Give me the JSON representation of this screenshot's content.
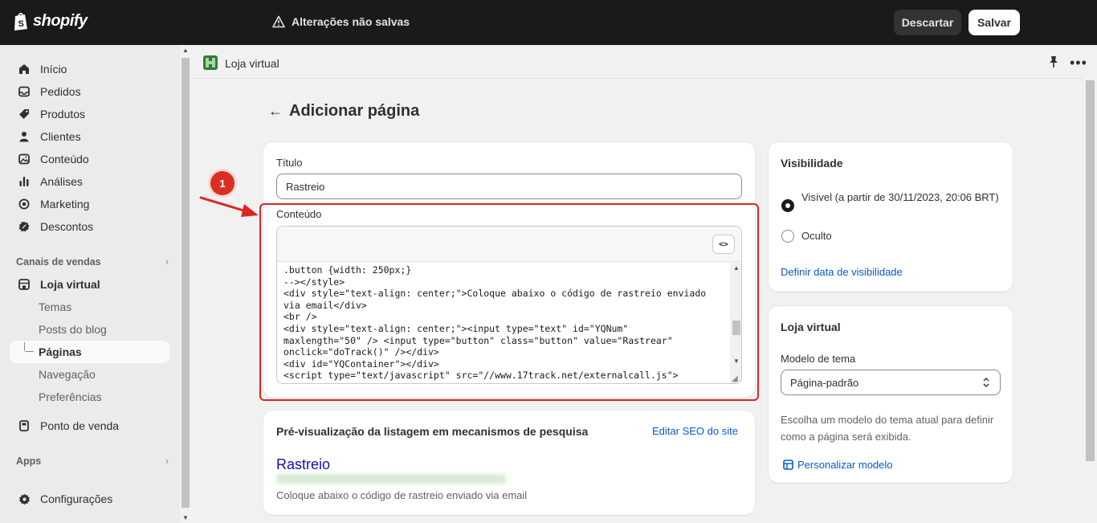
{
  "topbar": {
    "logo_text": "shopify",
    "unsaved_text": "Alterações não salvas",
    "discard_label": "Descartar",
    "save_label": "Salvar"
  },
  "sidebar": {
    "items": [
      {
        "label": "Início",
        "icon": "home-icon"
      },
      {
        "label": "Pedidos",
        "icon": "inbox-icon"
      },
      {
        "label": "Produtos",
        "icon": "tag-icon"
      },
      {
        "label": "Clientes",
        "icon": "person-icon"
      },
      {
        "label": "Conteúdo",
        "icon": "image-icon"
      },
      {
        "label": "Análises",
        "icon": "bar-chart-icon"
      },
      {
        "label": "Marketing",
        "icon": "target-icon"
      },
      {
        "label": "Descontos",
        "icon": "discount-icon"
      }
    ],
    "sales_channels_label": "Canais de vendas",
    "online_store": {
      "label": "Loja virtual",
      "icon": "storefront-icon",
      "subitems": [
        "Temas",
        "Posts do blog",
        "Páginas",
        "Navegação",
        "Preferências"
      ],
      "active": "Páginas"
    },
    "pos_label": "Ponto de venda",
    "apps_label": "Apps",
    "settings_label": "Configurações"
  },
  "header": {
    "store_name": "Loja virtual"
  },
  "page": {
    "title": "Adicionar página",
    "title_label": "Título",
    "title_value": "Rastreio",
    "content_label": "Conteúdo",
    "code_toggle": "<>",
    "code_lines": [
      ".button {width: 250px;}",
      "--></style>",
      "<div style=\"text-align: center;\">Coloque abaixo o código de rastreio enviado",
      "via email</div>",
      "<br />",
      "<div style=\"text-align: center;\"><input type=\"text\" id=\"YQNum\"",
      "maxlength=\"50\" /> <input type=\"button\" class=\"button\" value=\"Rastrear\"",
      "onclick=\"doTrack()\" /></div>",
      "<div id=\"YQContainer\"></div>",
      "<script type=\"text/javascript\" src=\"//www.17track.net/externalcall.js\">"
    ],
    "annotation_number": "1"
  },
  "seo": {
    "heading": "Pré-visualização da listagem em mecanismos de pesquisa",
    "edit_link": "Editar SEO do site",
    "preview_title": "Rastreio",
    "preview_description": "Coloque abaixo o código de rastreio enviado via email"
  },
  "visibility": {
    "heading": "Visibilidade",
    "visible_label": "Visível (a partir de 30/11/2023, 20:06 BRT)",
    "hidden_label": "Oculto",
    "selected": "visible",
    "set_date_link": "Definir data de visibilidade"
  },
  "template": {
    "heading": "Loja virtual",
    "theme_model_label": "Modelo de tema",
    "theme_model_value": "Página-padrão",
    "help_text": "Escolha um modelo do tema atual para definir como a página será exibida.",
    "customize_link": "Personalizar modelo"
  },
  "colors": {
    "topbar": "#1a1a1a",
    "link": "#005bd3",
    "highlight": "#e02424"
  }
}
